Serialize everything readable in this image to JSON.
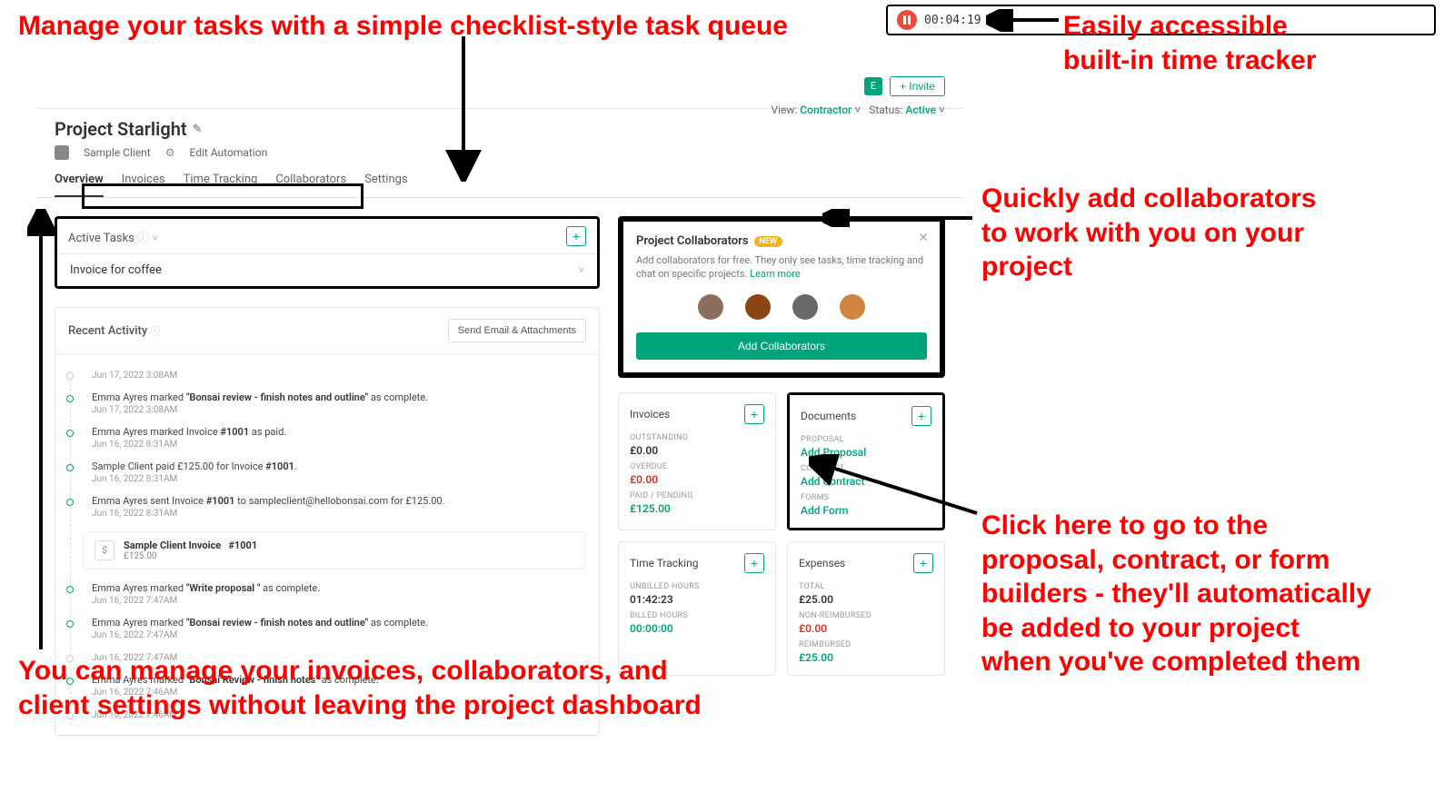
{
  "annotations": {
    "a_tasks": "Manage your tasks with a simple checklist-style task queue",
    "a_timer": "Easily accessible built-in time tracker",
    "a_collab": "Quickly add collaborators to work with you on your project",
    "a_docs": "Click here to go to the proposal, contract, or form builders - they'll automatically be added to your project when you've completed them",
    "a_tabs": "You can manage your invoices, collaborators, and client settings without leaving the project dashboard"
  },
  "timer": {
    "value": "00:04:19"
  },
  "header": {
    "title": "Project Starlight",
    "client": "Sample Client",
    "edit_auto": "Edit Automation",
    "invite": "+ Invite",
    "badge": "E",
    "view_label": "View:",
    "view_value": "Contractor",
    "status_label": "Status:",
    "status_value": "Active"
  },
  "tabs": [
    "Overview",
    "Invoices",
    "Time Tracking",
    "Collaborators",
    "Settings"
  ],
  "active_tasks": {
    "title": "Active Tasks",
    "items": [
      "Invoice for coffee"
    ]
  },
  "activity": {
    "title": "Recent Activity",
    "send_btn": "Send Email & Attachments",
    "items": [
      {
        "ts_only": "Jun 17, 2022 3:08AM"
      },
      {
        "text_pre": "Emma Ayres marked ",
        "bold": "\"Bonsai review - finish notes and outline\"",
        "text_post": " as complete.",
        "ts": "Jun 17, 2022 3:08AM"
      },
      {
        "text_pre": "Emma Ayres marked Invoice ",
        "bold": "#1001",
        "text_post": " as paid.",
        "ts": "Jun 16, 2022 8:31AM"
      },
      {
        "text_pre": "Sample Client paid £125.00 for Invoice ",
        "bold": "#1001",
        "text_post": ".",
        "ts": "Jun 16, 2022 8:31AM"
      },
      {
        "text_pre": "Emma Ayres sent Invoice ",
        "bold": "#1001",
        "text_post": " to sampleclient@hellobonsai.com for £125.00.",
        "ts": "Jun 16, 2022 8:31AM"
      },
      {
        "invoice": {
          "name": "Sample Client Invoice",
          "num": "#1001",
          "amt": "£125.00"
        }
      },
      {
        "text_pre": "Emma Ayres marked ",
        "bold": "\"Write proposal \"",
        "text_post": " as complete.",
        "ts": "Jun 16, 2022 7:47AM"
      },
      {
        "text_pre": "Emma Ayres marked ",
        "bold": "\"Bonsai review - finish notes and outline\"",
        "text_post": " as complete.",
        "ts": "Jun 16, 2022 7:47AM"
      },
      {
        "ts_only": "Jun 16, 2022 7:47AM"
      },
      {
        "text_pre": "Emma Ayres marked ",
        "bold": "\"Bonsai Review - finish notes\"",
        "text_post": " as complete.",
        "ts": "Jun 16, 2022 7:46AM"
      },
      {
        "ts_only": "Jun 16, 2022 7:46AM"
      }
    ]
  },
  "collab": {
    "title": "Project Collaborators",
    "pill": "NEW",
    "desc": "Add collaborators for free. They only see tasks, time tracking and chat on specific projects. ",
    "learn": "Learn more",
    "btn": "Add Collaborators"
  },
  "invoices": {
    "title": "Invoices",
    "outstanding_lbl": "OUTSTANDING",
    "outstanding": "£0.00",
    "overdue_lbl": "OVERDUE",
    "overdue": "£0.00",
    "paid_lbl": "PAID / PENDING",
    "paid": "£125.00"
  },
  "documents": {
    "title": "Documents",
    "proposal_lbl": "PROPOSAL",
    "proposal_link": "Add Proposal",
    "contract_lbl": "CONTRACT",
    "contract_link": "Add Contract",
    "forms_lbl": "FORMS",
    "forms_link": "Add Form"
  },
  "time": {
    "title": "Time Tracking",
    "unbilled_lbl": "UNBILLED HOURS",
    "unbilled": "01:42:23",
    "billed_lbl": "BILLED HOURS",
    "billed": "00:00:00"
  },
  "expenses": {
    "title": "Expenses",
    "total_lbl": "TOTAL",
    "total": "£25.00",
    "nonreimb_lbl": "NON-REIMBURSED",
    "nonreimb": "£0.00",
    "reimb_lbl": "REIMBURSED",
    "reimb": "£25.00"
  }
}
